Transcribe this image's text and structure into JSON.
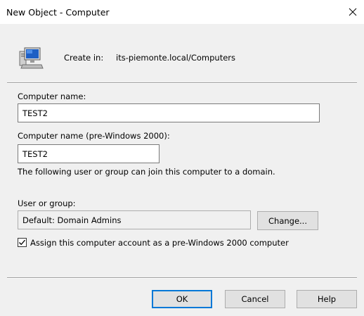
{
  "window": {
    "title": "New Object - Computer",
    "close_icon": "close-icon"
  },
  "header": {
    "icon": "computer-icon",
    "create_in_label": "Create in:",
    "create_in_value": "its-piemonte.local/Computers"
  },
  "form": {
    "computer_name_label": "Computer name:",
    "computer_name_value": "TEST2",
    "pre2000_label": "Computer name (pre-Windows 2000):",
    "pre2000_value": "TEST2",
    "join_info": "The following user or group can join this computer to a domain.",
    "user_group_label": "User or group:",
    "user_group_value": "Default: Domain Admins",
    "change_button": "Change...",
    "assign_checkbox_checked": true,
    "assign_checkbox_label": "Assign this computer account as a pre-Windows 2000 computer"
  },
  "footer": {
    "ok": "OK",
    "cancel": "Cancel",
    "help": "Help"
  },
  "colors": {
    "panel_bg": "#f0f0f0",
    "button_bg": "#e1e1e1",
    "default_button_border": "#0078d7"
  }
}
